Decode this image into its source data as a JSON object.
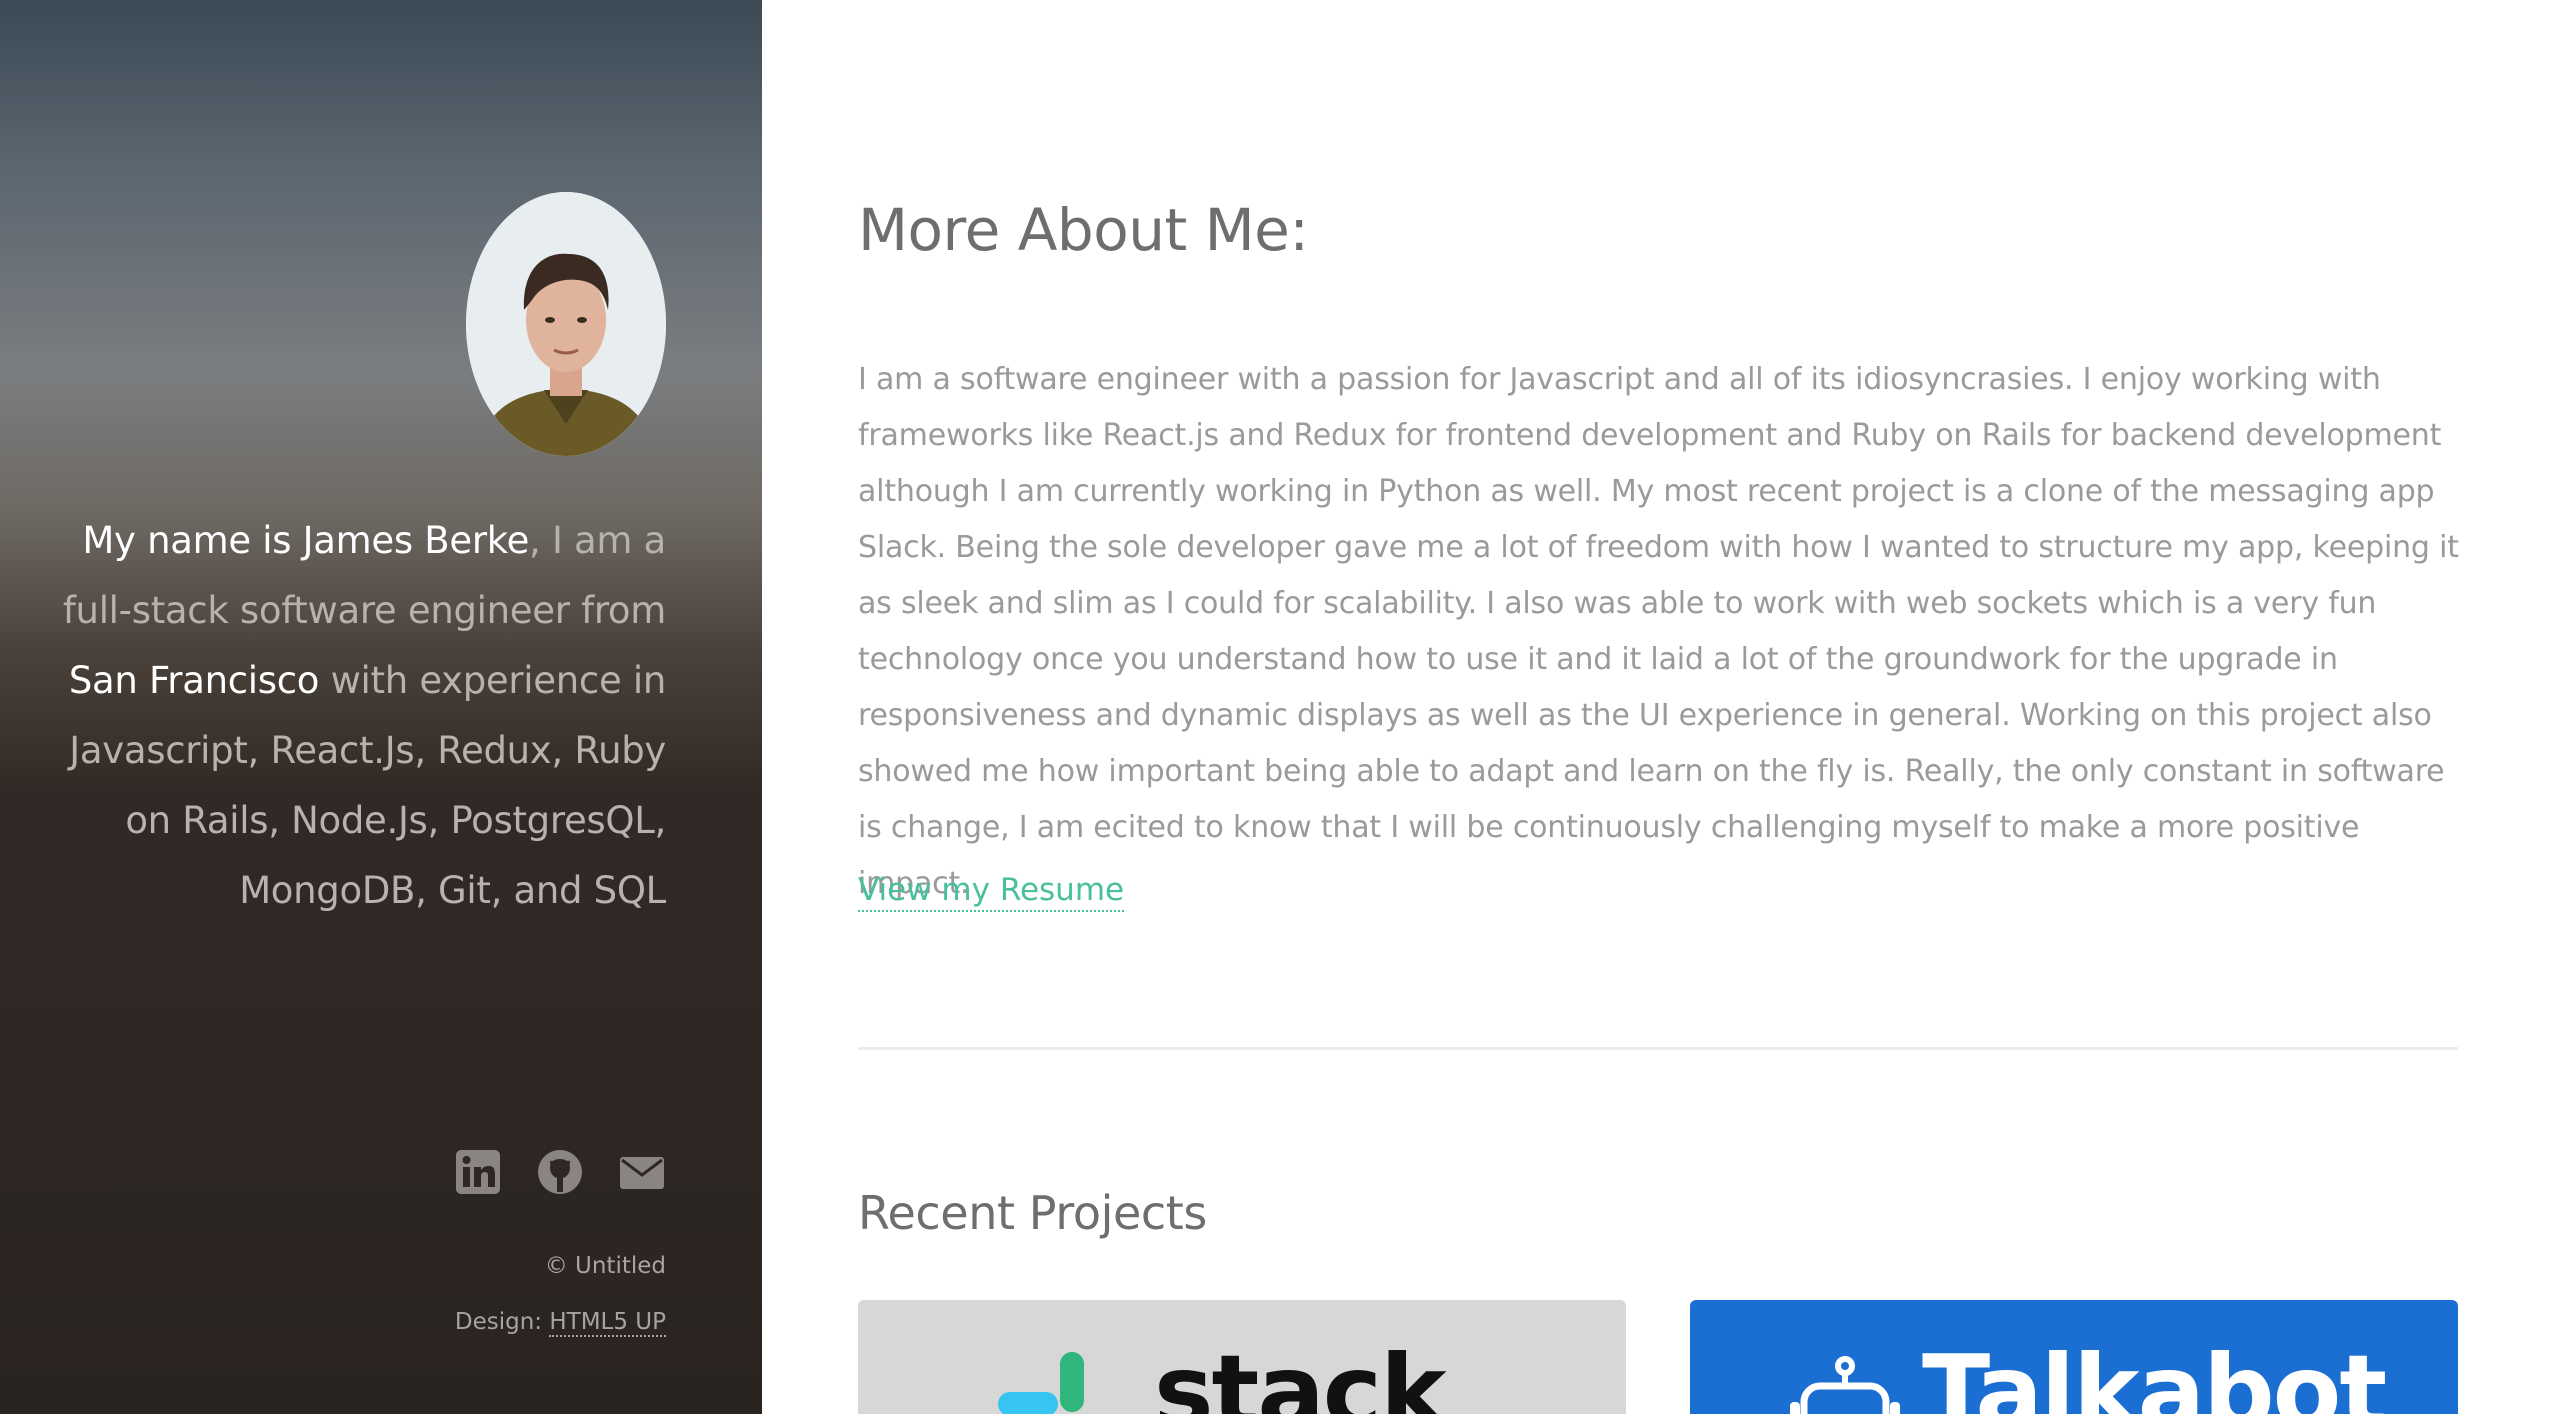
{
  "sidebar": {
    "bio": {
      "name_intro": "My name is James Berke",
      "part1": ", I am a full-stack software engineer from ",
      "city": "San Francisco",
      "part2": " with experience in Javascript, React.Js, Redux, Ruby on Rails, Node.Js, PostgresQL, MongoDB, Git, and SQL"
    },
    "social": {
      "icons": [
        "linkedin-icon",
        "github-icon",
        "envelope-icon"
      ]
    },
    "footer": {
      "copyright": "© Untitled",
      "design_label": "Design: ",
      "design_link": "HTML5 UP"
    }
  },
  "main": {
    "about_title": "More About Me:",
    "about_text": "I am a software engineer with a passion for Javascript and all of its idiosyncrasies. I enjoy working with frameworks like React.js and Redux for frontend development and Ruby on Rails for backend development although I am currently working in Python as well. My most recent project is a clone of the messaging app Slack. Being the sole developer gave me a lot of freedom with how I wanted to structure my app, keeping it as sleek and slim as I could for scalability. I also was able to work with web sockets which is a very fun technology once you understand how to use it and it laid a lot of the groundwork for the upgrade in responsiveness and dynamic displays as well as the UI experience in general. Working on this project also showed me how important being able to adapt and learn on the fly is. Really, the only constant in software is change, I am ecited to know that I will be continuously challenging myself to make a more positive impact.",
    "resume_link": "View my Resume",
    "projects_title": "Recent Projects",
    "projects": [
      {
        "logo_text": "stack",
        "icon": "slack-logo-icon"
      },
      {
        "logo_text": "Talkabot",
        "icon": "robot-icon"
      }
    ]
  },
  "colors": {
    "accent": "#49bf9d",
    "text_muted": "#9a9a9a",
    "heading": "#6e6e6e",
    "talk_card_bg": "#1b6fd3"
  }
}
